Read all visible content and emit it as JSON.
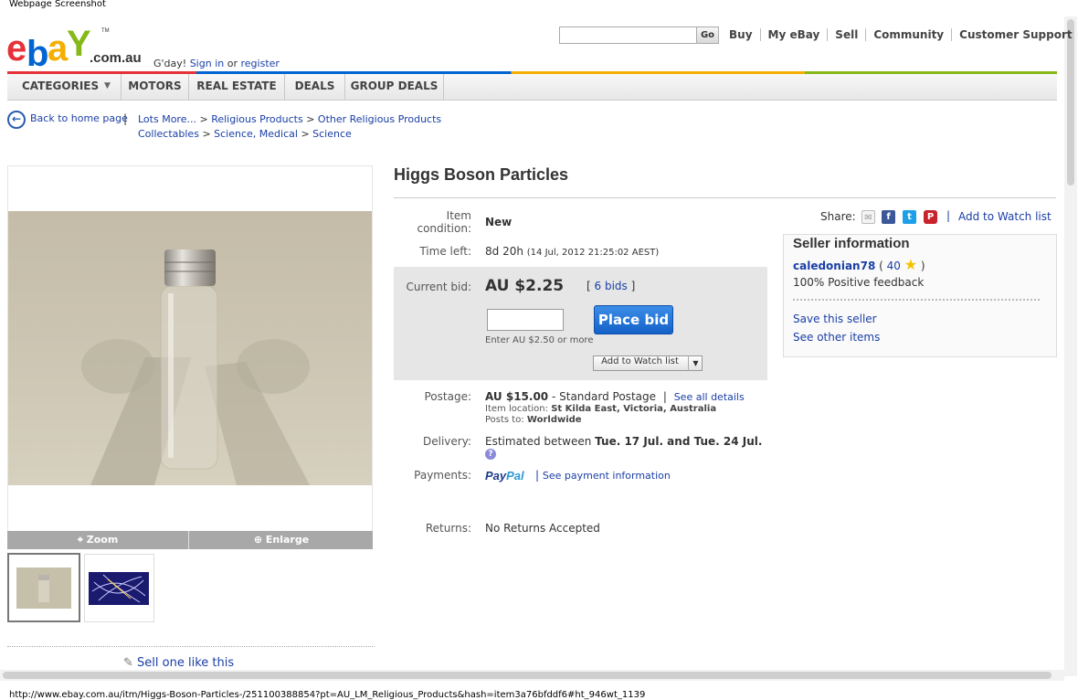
{
  "window": {
    "title": "Webpage Screenshot",
    "status_url": "http://www.ebay.com.au/itm/Higgs-Boson-Particles-/251100388854?pt=AU_LM_Religious_Products&hash=item3a76bfddf6#ht_946wt_1139"
  },
  "header": {
    "logo_letters": [
      "e",
      "b",
      "a",
      "Y"
    ],
    "logo_suffix": ".com.au",
    "logo_tm": "TM",
    "greeting": "G'day!",
    "sign_in": "Sign in",
    "or": "or",
    "register": "register",
    "search_placeholder": "",
    "go_label": "Go",
    "top_nav": [
      "Buy",
      "My eBay",
      "Sell",
      "Community",
      "Customer Support"
    ]
  },
  "category_bar": {
    "items": [
      "CATEGORIES",
      "MOTORS",
      "REAL ESTATE",
      "DEALS",
      "GROUP DEALS"
    ],
    "dropdown_arrow": "▼"
  },
  "breadcrumb": {
    "back_label": "Back to home page",
    "separator": "|",
    "line1": [
      "Lots More...",
      "Religious Products",
      "Other Religious Products"
    ],
    "line2": [
      "Collectables",
      "Science, Medical",
      "Science"
    ],
    "gt": ">"
  },
  "image_panel": {
    "zoom_label": "Zoom",
    "enlarge_label": "Enlarge",
    "sell_one": "Sell one like this"
  },
  "item": {
    "title": "Higgs Boson Particles",
    "condition_label": "Item condition:",
    "condition_label_line1": "Item",
    "condition_label_line2": "condition:",
    "condition_value": "New",
    "time_left_label": "Time left:",
    "time_left_value": "8d 20h",
    "time_left_date": "(14 Jul, 2012 21:25:02 AEST)",
    "current_bid_label": "Current bid:",
    "current_bid_value": "AU $2.25",
    "bids_open": "[",
    "bids_link": "6 bids",
    "bids_close": "]",
    "bid_input_value": "",
    "place_bid": "Place bid",
    "bid_hint": "Enter AU $2.50 or more",
    "add_watch_button": "Add to Watch list",
    "postage_label": "Postage:",
    "postage_value": "AU $15.00",
    "postage_service": "- Standard Postage",
    "postage_sep": "|",
    "see_all_details": "See all details",
    "item_location_label": "Item location:",
    "item_location_value": "St Kilda East, Victoria, Australia",
    "posts_to_label": "Posts to:",
    "posts_to_value": "Worldwide",
    "delivery_label": "Delivery:",
    "delivery_prefix": "Estimated between",
    "delivery_range": "Tue. 17 Jul. and Tue. 24 Jul.",
    "payments_label": "Payments:",
    "paypal_part1": "Pay",
    "paypal_part2": "Pal",
    "payments_sep": "|",
    "see_payment_info": "See payment information",
    "returns_label": "Returns:",
    "returns_value": "No Returns Accepted"
  },
  "share": {
    "label": "Share:",
    "separator": "|",
    "add_watch_link": "Add to Watch list",
    "icons": [
      "email-icon",
      "facebook-icon",
      "twitter-icon",
      "pinterest-icon"
    ]
  },
  "seller": {
    "title": "Seller information",
    "name": "caledonian78",
    "open_paren": "(",
    "feedback_score": "40",
    "close_paren": ")",
    "positive_feedback": "100% Positive feedback",
    "save_seller": "Save this seller",
    "other_items": "See other items"
  },
  "colors": {
    "link": "#1a3fa6",
    "place_bid_bg": "#1561c8",
    "logo_e": "#e53238",
    "logo_b": "#0064d2",
    "logo_a": "#f5af02",
    "logo_y": "#86b817"
  }
}
